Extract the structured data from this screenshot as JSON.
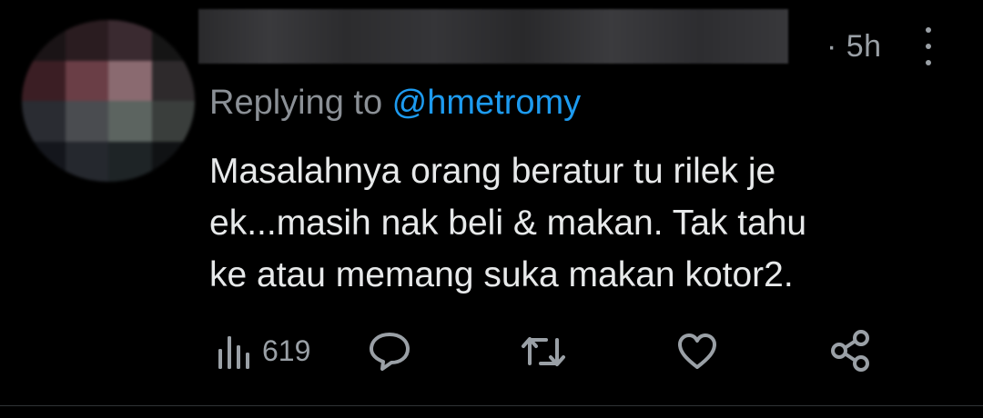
{
  "tweet": {
    "timestamp": "· 5h",
    "replying_prefix": "Replying to ",
    "replying_handle": "@hmetromy",
    "body_lines": [
      "Masalahnya orang beratur tu rilek je",
      "ek...masih nak beli & makan. Tak tahu",
      "ke atau memang suka makan kotor2."
    ],
    "actions": {
      "views_count": "619"
    }
  },
  "colors": {
    "background": "#000000",
    "text": "#e7e9ea",
    "muted": "#9aa0a6",
    "link": "#1d9bf0"
  },
  "icons": {
    "views": "analytics-icon",
    "reply": "reply-icon",
    "retweet": "retweet-icon",
    "like": "heart-icon",
    "share": "share-icon",
    "more": "more-vertical-icon"
  }
}
